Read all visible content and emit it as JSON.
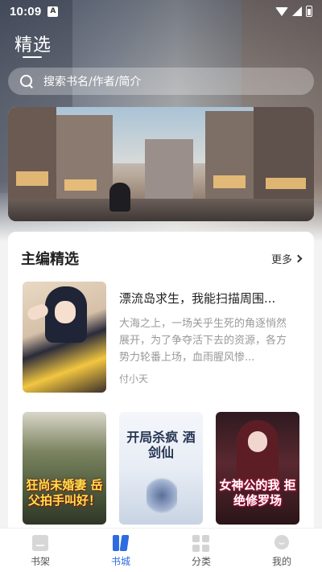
{
  "status_bar": {
    "time": "10:09",
    "notif_badge": "A"
  },
  "header": {
    "title": "精选",
    "search_placeholder": "搜索书名/作者/简介"
  },
  "editor_picks": {
    "title": "主编精选",
    "more_label": "更多",
    "featured": {
      "title": "漂流岛求生，我能扫描周围...",
      "description": "大海之上，一场关乎生死的角逐悄然展开，为了争夺活下去的资源，各方势力轮番上场，血雨腥风惨...",
      "author": "付小天"
    },
    "covers": [
      {
        "text": "狂尚未婚妻 岳父拍手叫好！"
      },
      {
        "text": "开局杀疯 酒剑仙"
      },
      {
        "text": "女神公的我 拒绝修罗场"
      }
    ]
  },
  "tabs": [
    {
      "label": "书架",
      "icon": "bookshelf-icon",
      "active": false
    },
    {
      "label": "书城",
      "icon": "bookstore-icon",
      "active": true
    },
    {
      "label": "分类",
      "icon": "category-icon",
      "active": false
    },
    {
      "label": "我的",
      "icon": "profile-icon",
      "active": false
    }
  ],
  "colors": {
    "accent": "#2f6be0",
    "inactive_tab": "#555555",
    "muted_text": "#999999"
  }
}
